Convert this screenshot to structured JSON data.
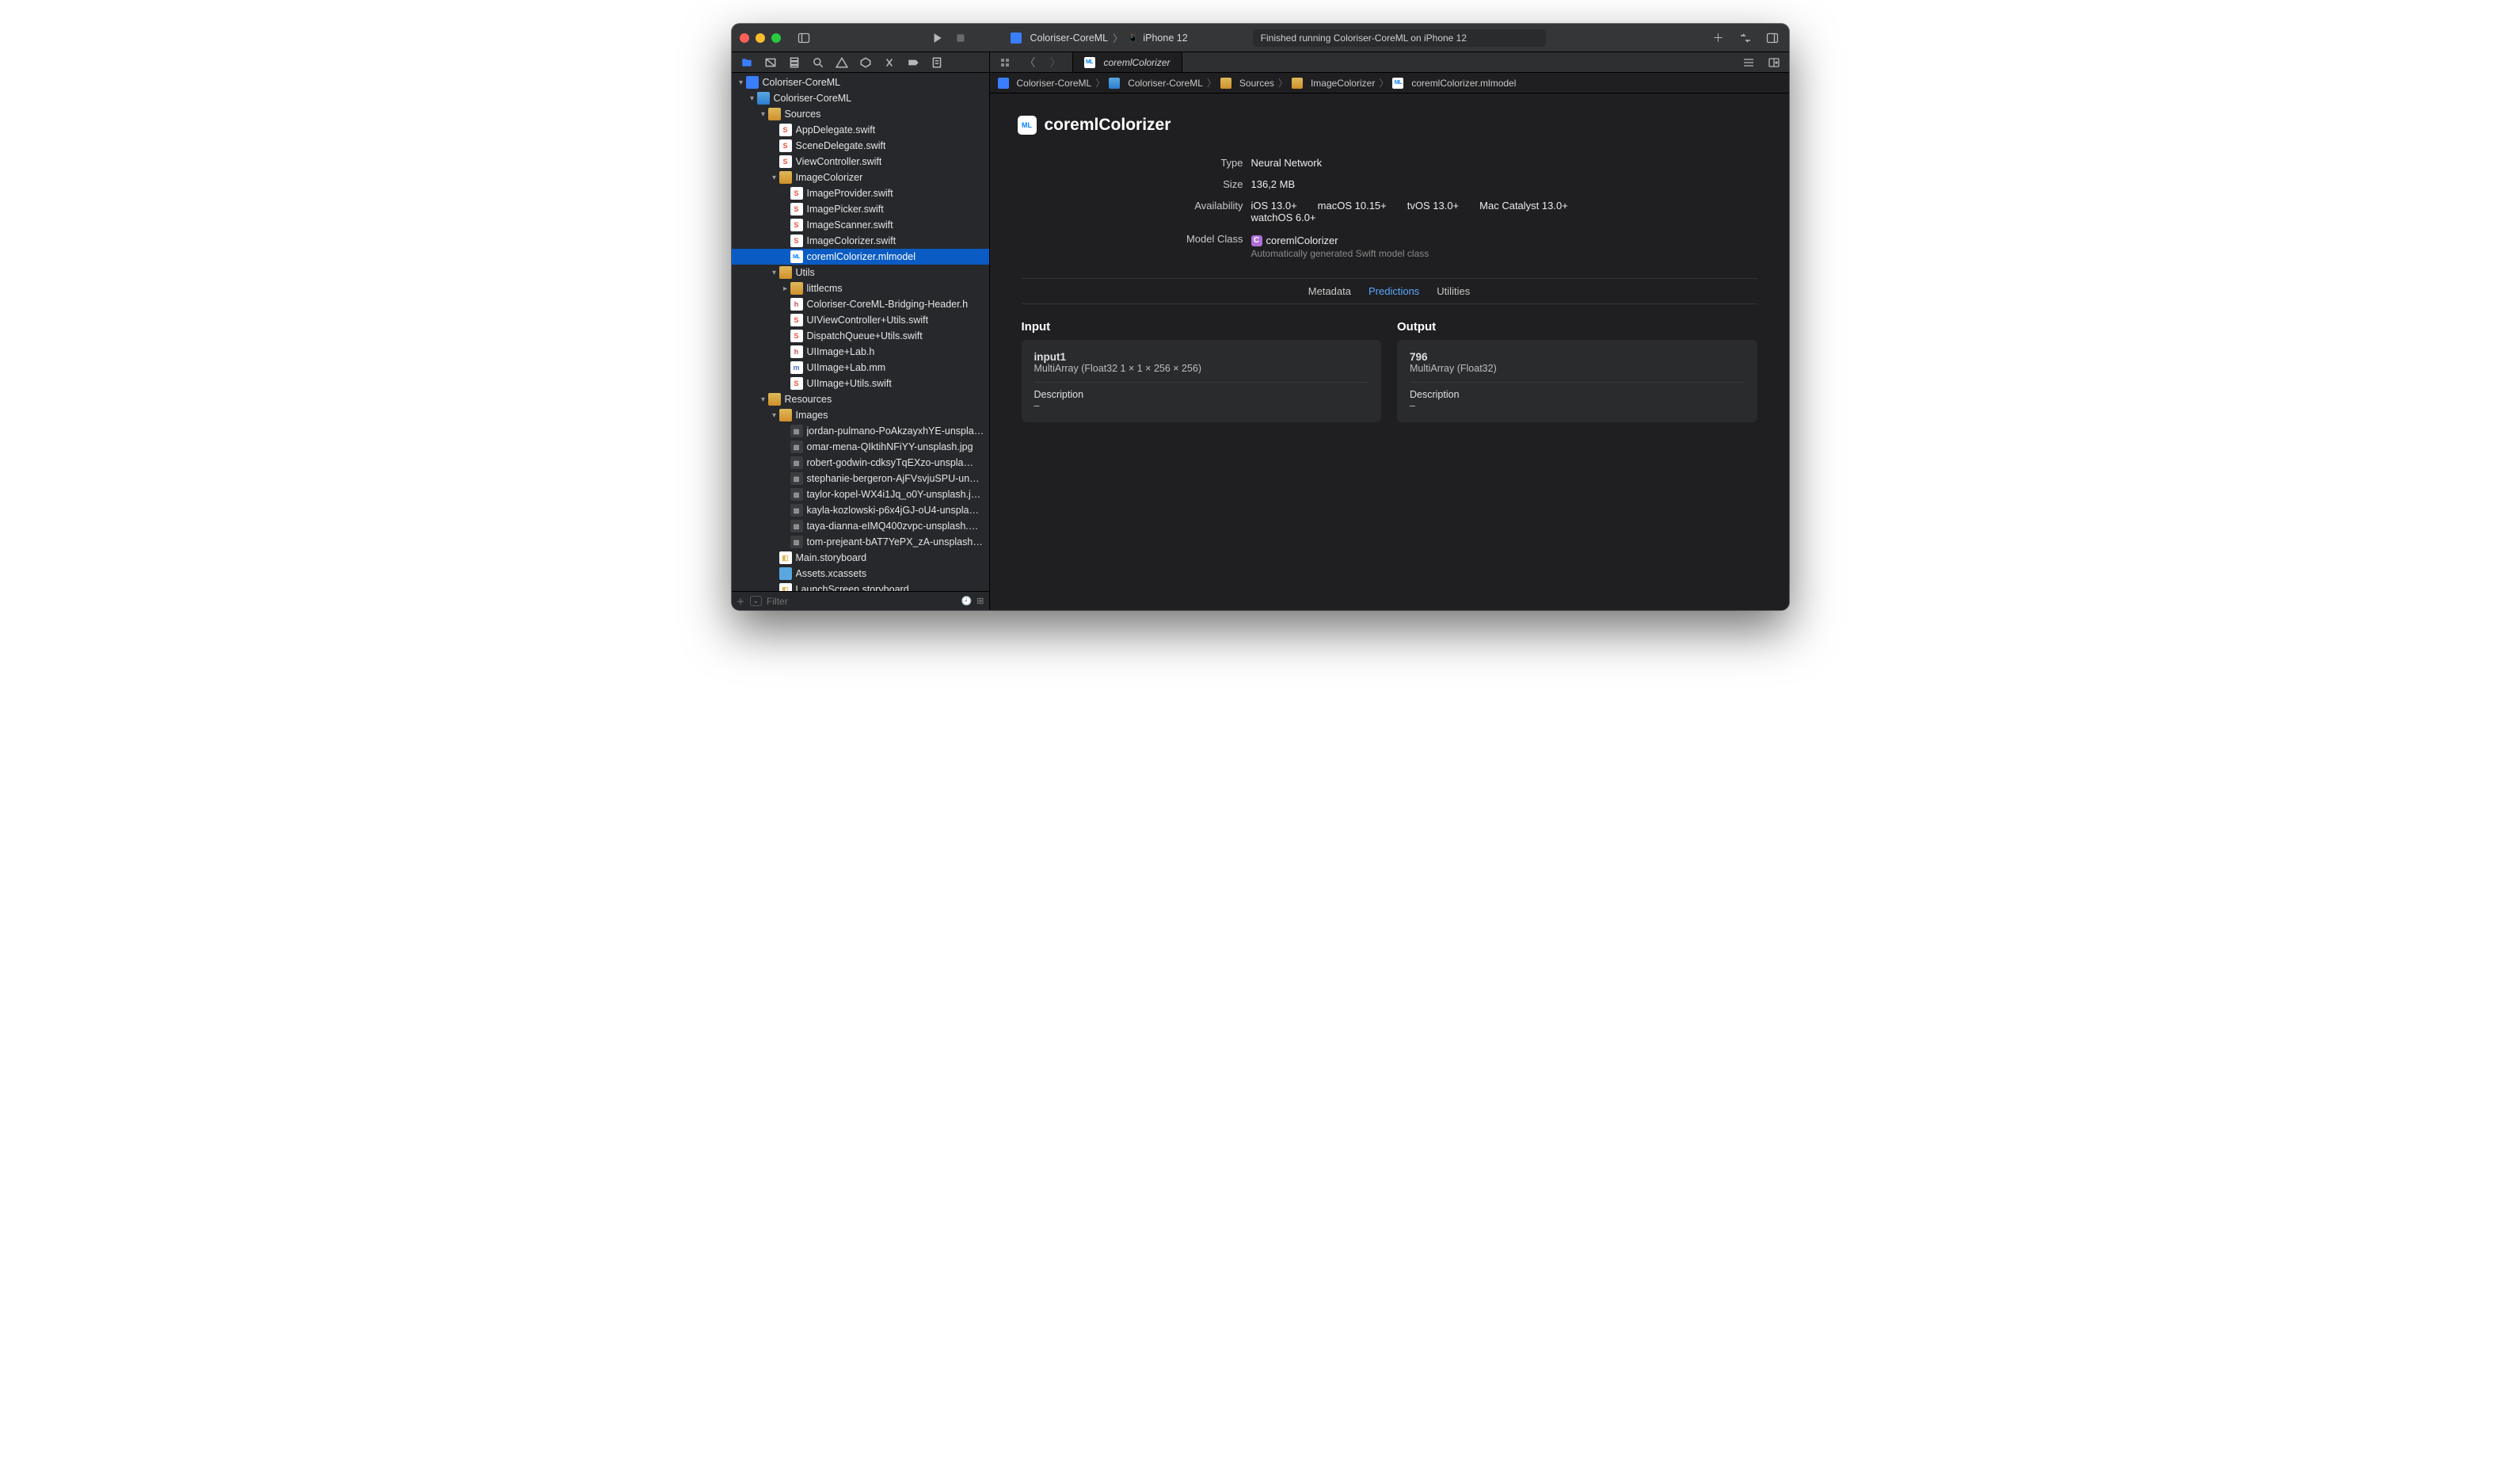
{
  "traffic": {
    "close": "#ff5f57",
    "min": "#febc2e",
    "max": "#28c840"
  },
  "toolbar": {
    "scheme": "Coloriser-CoreML",
    "destination": "iPhone 12",
    "status": "Finished running Coloriser-CoreML on iPhone 12"
  },
  "editor_tab": "coremlColorizer",
  "crumbs": [
    {
      "icon": "proj",
      "label": "Coloriser-CoreML"
    },
    {
      "icon": "folder",
      "label": "Coloriser-CoreML"
    },
    {
      "icon": "folder-y",
      "label": "Sources"
    },
    {
      "icon": "folder-y",
      "label": "ImageColorizer"
    },
    {
      "icon": "ml",
      "label": "coremlColorizer.mlmodel"
    }
  ],
  "tree": [
    {
      "d": 0,
      "icon": "proj",
      "label": "Coloriser-CoreML",
      "disc": "down"
    },
    {
      "d": 1,
      "icon": "folder",
      "label": "Coloriser-CoreML",
      "disc": "down"
    },
    {
      "d": 2,
      "icon": "folder-y",
      "label": "Sources",
      "disc": "down"
    },
    {
      "d": 3,
      "icon": "swift",
      "label": "AppDelegate.swift"
    },
    {
      "d": 3,
      "icon": "swift",
      "label": "SceneDelegate.swift"
    },
    {
      "d": 3,
      "icon": "swift",
      "label": "ViewController.swift"
    },
    {
      "d": 3,
      "icon": "folder-y",
      "label": "ImageColorizer",
      "disc": "down"
    },
    {
      "d": 4,
      "icon": "swift",
      "label": "ImageProvider.swift"
    },
    {
      "d": 4,
      "icon": "swift",
      "label": "ImagePicker.swift"
    },
    {
      "d": 4,
      "icon": "swift",
      "label": "ImageScanner.swift"
    },
    {
      "d": 4,
      "icon": "swift",
      "label": "ImageColorizer.swift"
    },
    {
      "d": 4,
      "icon": "ml",
      "label": "coremlColorizer.mlmodel",
      "selected": true
    },
    {
      "d": 3,
      "icon": "folder-y",
      "label": "Utils",
      "disc": "down"
    },
    {
      "d": 4,
      "icon": "folder-y",
      "label": "littlecms",
      "disc": "right"
    },
    {
      "d": 4,
      "icon": "objc-h",
      "label": "Coloriser-CoreML-Bridging-Header.h"
    },
    {
      "d": 4,
      "icon": "swift",
      "label": "UIViewController+Utils.swift"
    },
    {
      "d": 4,
      "icon": "swift",
      "label": "DispatchQueue+Utils.swift"
    },
    {
      "d": 4,
      "icon": "objc-h",
      "label": "UIImage+Lab.h"
    },
    {
      "d": 4,
      "icon": "objc-m",
      "label": "UIImage+Lab.mm"
    },
    {
      "d": 4,
      "icon": "swift",
      "label": "UIImage+Utils.swift"
    },
    {
      "d": 2,
      "icon": "folder-y",
      "label": "Resources",
      "disc": "down"
    },
    {
      "d": 3,
      "icon": "folder-y",
      "label": "Images",
      "disc": "down"
    },
    {
      "d": 4,
      "icon": "image",
      "label": "jordan-pulmano-PoAkzayxhYE-unspla…"
    },
    {
      "d": 4,
      "icon": "image",
      "label": "omar-mena-QIktihNFiYY-unsplash.jpg"
    },
    {
      "d": 4,
      "icon": "image",
      "label": "robert-godwin-cdksyTqEXzo-unspla…"
    },
    {
      "d": 4,
      "icon": "image",
      "label": "stephanie-bergeron-AjFVsvjuSPU-un…"
    },
    {
      "d": 4,
      "icon": "image",
      "label": "taylor-kopel-WX4i1Jq_o0Y-unsplash.j…"
    },
    {
      "d": 4,
      "icon": "image",
      "label": "kayla-kozlowski-p6x4jGJ-oU4-unspla…"
    },
    {
      "d": 4,
      "icon": "image",
      "label": "taya-dianna-eIMQ400zvpc-unsplash.…"
    },
    {
      "d": 4,
      "icon": "image",
      "label": "tom-prejeant-bAT7YePX_zA-unsplash…"
    },
    {
      "d": 3,
      "icon": "sb",
      "label": "Main.storyboard"
    },
    {
      "d": 3,
      "icon": "assets",
      "label": "Assets.xcassets"
    },
    {
      "d": 3,
      "icon": "sb",
      "label": "LaunchScreen.storyboard"
    }
  ],
  "filter_placeholder": "Filter",
  "ml": {
    "title": "coremlColorizer",
    "type_label": "Type",
    "type": "Neural Network",
    "size_label": "Size",
    "size": "136,2 MB",
    "avail_label": "Availability",
    "avail_line1": "iOS 13.0+  macOS 10.15+  tvOS 13.0+  Mac Catalyst 13.0+",
    "avail_line2": "watchOS 6.0+",
    "class_label": "Model Class",
    "class_name": "coremlColorizer",
    "class_sub": "Automatically generated Swift model class",
    "tabs": {
      "metadata": "Metadata",
      "predictions": "Predictions",
      "utilities": "Utilities"
    },
    "input": {
      "heading": "Input",
      "name": "input1",
      "type": "MultiArray (Float32 1 × 1 × 256 × 256)",
      "desc_label": "Description",
      "desc_val": "–"
    },
    "output": {
      "heading": "Output",
      "name": "796",
      "type": "MultiArray (Float32)",
      "desc_label": "Description",
      "desc_val": "–"
    }
  }
}
